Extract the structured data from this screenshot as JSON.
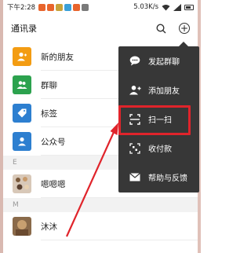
{
  "statusbar": {
    "time": "下午2:28",
    "net_speed": "5.03K/s"
  },
  "header": {
    "title": "通讯录"
  },
  "contacts": {
    "fixed_items": [
      {
        "label": "新的朋友",
        "icon": "new-friend-icon",
        "color": "#f39c12"
      },
      {
        "label": "群聊",
        "icon": "group-chat-icon",
        "color": "#2ca24e"
      },
      {
        "label": "标签",
        "icon": "tag-icon",
        "color": "#2d7fd0"
      },
      {
        "label": "公众号",
        "icon": "official-account-icon",
        "color": "#2d7fd0"
      }
    ],
    "section_e": "E",
    "contact_e": "嗯嗯嗯",
    "section_m": "M",
    "contact_m": "沐沐"
  },
  "popup_menu": {
    "items": [
      {
        "label": "发起群聊",
        "icon": "chat-bubble-icon"
      },
      {
        "label": "添加朋友",
        "icon": "add-friend-icon"
      },
      {
        "label": "扫一扫",
        "icon": "scan-icon"
      },
      {
        "label": "收付款",
        "icon": "payment-icon"
      },
      {
        "label": "帮助与反馈",
        "icon": "mail-icon"
      }
    ]
  },
  "colors": {
    "highlight": "#e0242b",
    "popup_bg": "#373737"
  }
}
